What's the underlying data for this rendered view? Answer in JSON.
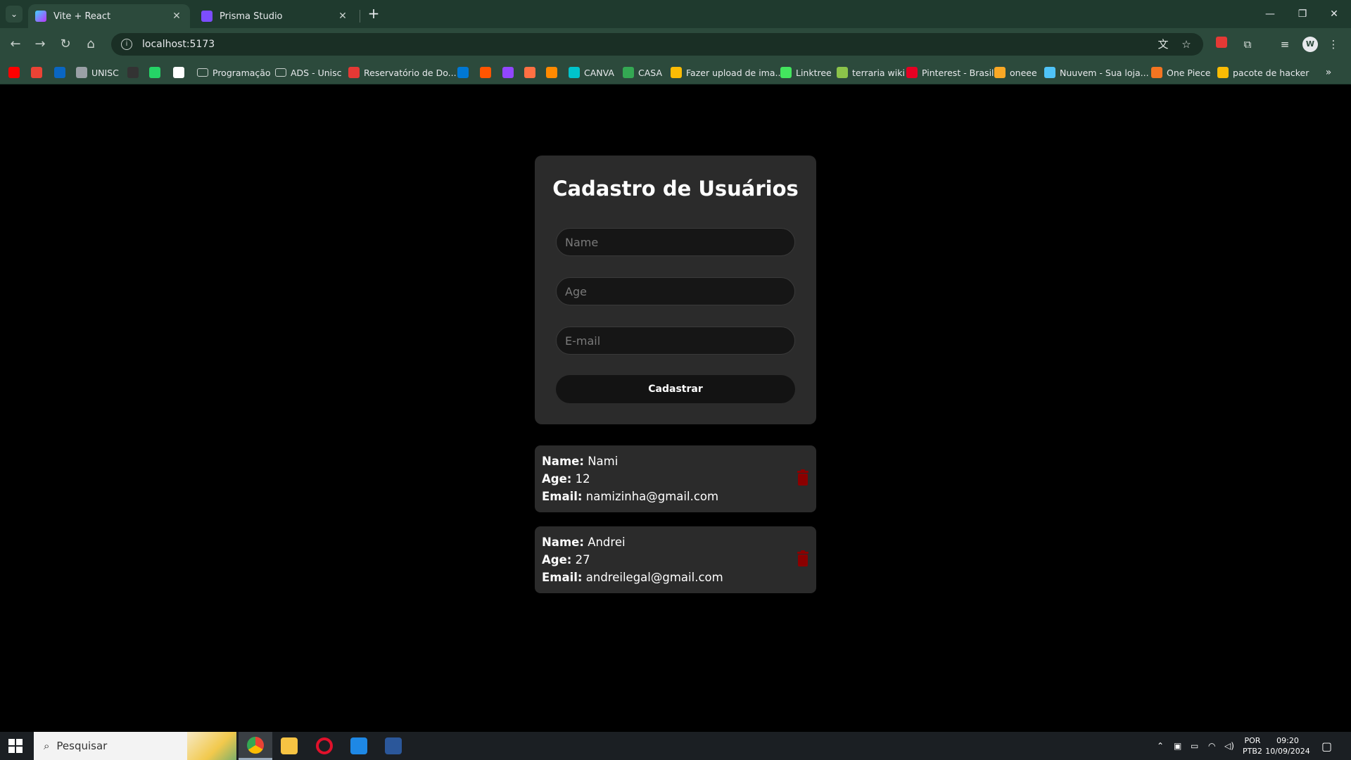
{
  "browser": {
    "tabs": [
      {
        "title": "Vite + React",
        "favicon": "vite-icon",
        "active": true
      },
      {
        "title": "Prisma Studio",
        "favicon": "prisma-icon",
        "active": false
      }
    ],
    "address": "localhost:5173",
    "bookmarks": [
      {
        "label": "",
        "icon": "youtube-icon",
        "color": "#ff0000"
      },
      {
        "label": "",
        "icon": "gmail-icon",
        "color": "#ea4335"
      },
      {
        "label": "",
        "icon": "linkedin-icon",
        "color": "#0a66c2"
      },
      {
        "label": "UNISC",
        "icon": "globe-icon",
        "color": "#9aa0a6"
      },
      {
        "label": "",
        "icon": "github-icon",
        "color": "#333333"
      },
      {
        "label": "",
        "icon": "whatsapp-icon",
        "color": "#25d366"
      },
      {
        "label": "",
        "icon": "notion-icon",
        "color": "#ffffff"
      },
      {
        "label": "Programação",
        "icon": "folder-icon",
        "color": "#c8d0cc"
      },
      {
        "label": "ADS - Unisc",
        "icon": "folder-icon",
        "color": "#c8d0cc"
      },
      {
        "label": "Reservatório de Do...",
        "icon": "pin-icon",
        "color": "#e53935"
      },
      {
        "label": "",
        "icon": "outlook-icon",
        "color": "#0078d4"
      },
      {
        "label": "",
        "icon": "soundcloud-icon",
        "color": "#ff5500"
      },
      {
        "label": "",
        "icon": "twitch-icon",
        "color": "#9146ff"
      },
      {
        "label": "",
        "icon": "app-icon",
        "color": "#ff7043"
      },
      {
        "label": "",
        "icon": "app-icon",
        "color": "#ff8a00"
      },
      {
        "label": "CANVA",
        "icon": "canva-icon",
        "color": "#00c4cc"
      },
      {
        "label": "CASA",
        "icon": "sheets-icon",
        "color": "#34a853"
      },
      {
        "label": "Fazer upload de ima...",
        "icon": "upload-icon",
        "color": "#fbbc04"
      },
      {
        "label": "Linktree",
        "icon": "linktree-icon",
        "color": "#43e55e"
      },
      {
        "label": "terraria wiki",
        "icon": "terraria-icon",
        "color": "#8bc34a"
      },
      {
        "label": "Pinterest - Brasil",
        "icon": "pinterest-icon",
        "color": "#e60023"
      },
      {
        "label": "oneee",
        "icon": "app-icon",
        "color": "#f9a825"
      },
      {
        "label": "Nuuvem - Sua loja...",
        "icon": "nuuvem-icon",
        "color": "#4fc3f7"
      },
      {
        "label": "One Piece",
        "icon": "crunchyroll-icon",
        "color": "#f47521"
      },
      {
        "label": "pacote de hacker",
        "icon": "drive-icon",
        "color": "#fbbc04"
      }
    ]
  },
  "form": {
    "title": "Cadastro de Usuários",
    "name_placeholder": "Name",
    "age_placeholder": "Age",
    "email_placeholder": "E-mail",
    "submit_label": "Cadastrar"
  },
  "labels": {
    "name": "Name:",
    "age": "Age:",
    "email": "Email:"
  },
  "users": [
    {
      "name": "Nami",
      "age": "12",
      "email": "namizinha@gmail.com"
    },
    {
      "name": "Andrei",
      "age": "27",
      "email": "andreilegal@gmail.com"
    }
  ],
  "taskbar": {
    "search_placeholder": "Pesquisar",
    "apps": [
      "chrome-icon",
      "file-explorer-icon",
      "opera-icon",
      "vscode-icon",
      "word-icon"
    ],
    "lang": "POR",
    "layout": "PTB2",
    "time": "09:20",
    "date": "10/09/2024"
  },
  "colors": {
    "delete": "#8b0000",
    "card": "#2b2b2b",
    "chrome": "#2c4a3c"
  }
}
